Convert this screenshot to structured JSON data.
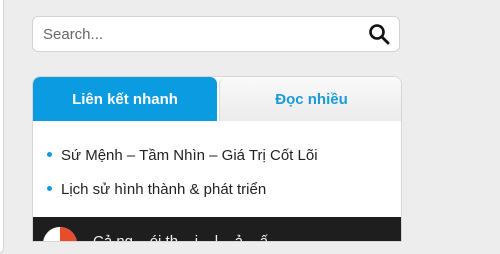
{
  "search": {
    "placeholder": "Search...",
    "icon": "search-icon"
  },
  "tabs": [
    {
      "label": "Liên kết nhanh",
      "active": true
    },
    {
      "label": "Đọc nhiều",
      "active": false
    }
  ],
  "quick_links": [
    {
      "label": "Sứ Mệnh – Tầm Nhìn – Giá Trị Cốt Lõi"
    },
    {
      "label": "Lịch sử hình thành & phát triển"
    }
  ],
  "media": {
    "caption": "Cả ng... ói th... ị... l... ả... ấ..."
  },
  "colors": {
    "accent": "#0b9be0",
    "inactive_tab_text": "#1a9ad6",
    "background": "#ededed"
  }
}
